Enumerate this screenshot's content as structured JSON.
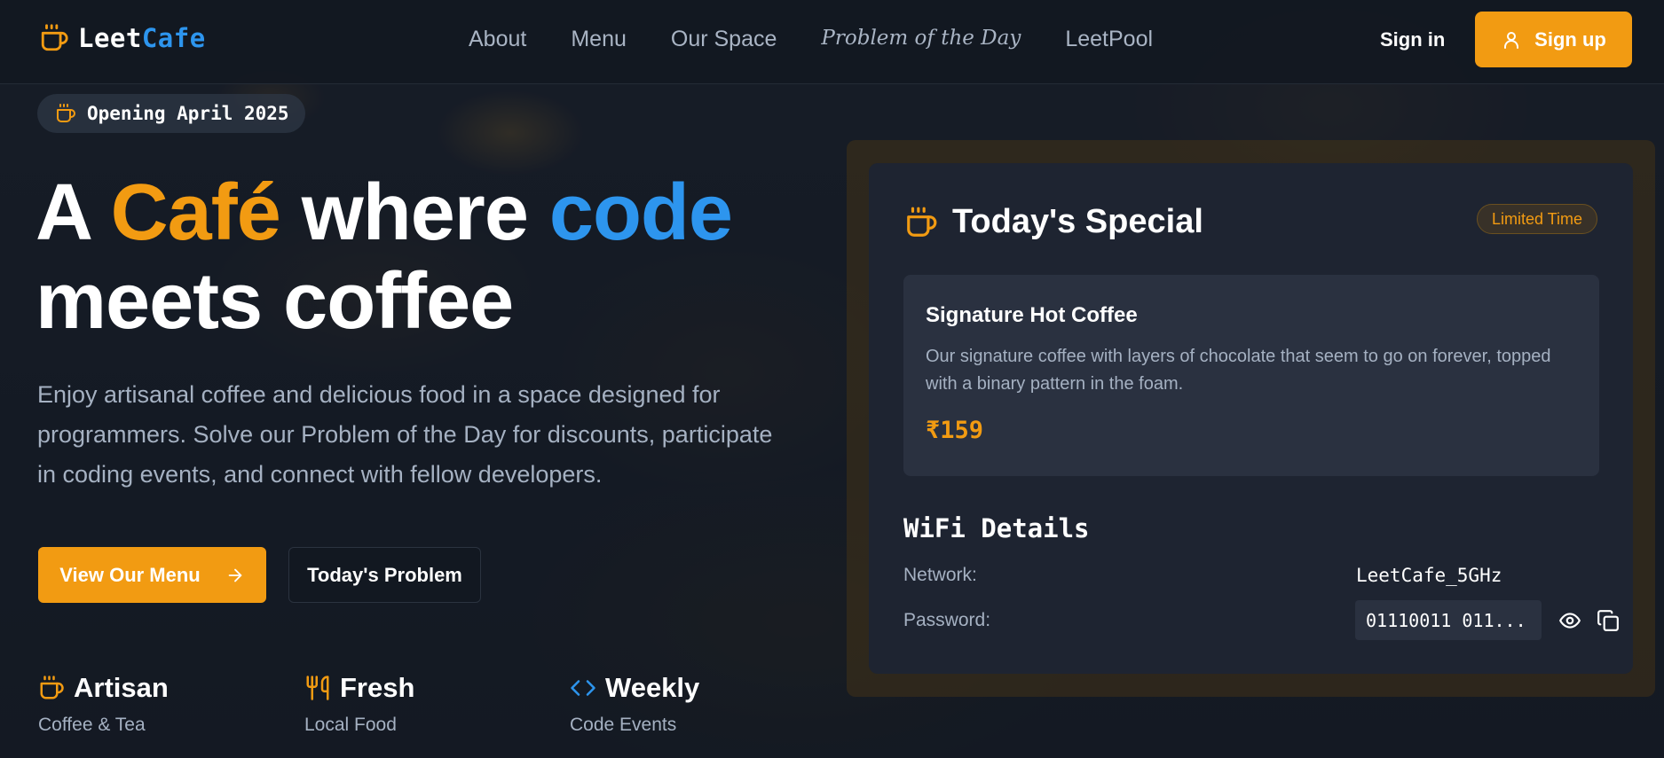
{
  "colors": {
    "accent": "#f29b12",
    "brand_blue": "#2d95ee",
    "muted": "#a5b1c2",
    "card": "#1e2431"
  },
  "header": {
    "logo_part1": "Leet",
    "logo_part2": "Cafe",
    "logo_icon": "coffee-cup-icon",
    "nav": [
      "About",
      "Menu",
      "Our Space",
      "Problem of the Day",
      "LeetPool"
    ],
    "signin": "Sign in",
    "signup": "Sign up",
    "signup_icon": "user-icon"
  },
  "hero": {
    "badge": "Opening April 2025",
    "title_a": "A",
    "title_cafe": "Café",
    "title_where": "where",
    "title_code": "code",
    "title_line2": "meets coffee",
    "description": "Enjoy artisanal coffee and delicious food in a space designed for programmers. Solve our Problem of the Day for discounts, participate in coding events, and connect with fellow developers.",
    "btn_menu": "View Our Menu",
    "btn_problem": "Today's Problem",
    "features": [
      {
        "title": "Artisan",
        "sub": "Coffee & Tea",
        "icon": "coffee-cup-icon"
      },
      {
        "title": "Fresh",
        "sub": "Local Food",
        "icon": "utensils-icon"
      },
      {
        "title": "Weekly",
        "sub": "Code Events",
        "icon": "code-icon"
      }
    ]
  },
  "special": {
    "title": "Today's Special",
    "tag": "Limited Time",
    "item_name": "Signature Hot Coffee",
    "item_desc": "Our signature coffee with layers of chocolate that seem to go on forever, topped with a binary pattern in the foam.",
    "price": "₹159"
  },
  "wifi": {
    "title": "WiFi Details",
    "network_label": "Network:",
    "network_value": "LeetCafe_5GHz",
    "password_label": "Password:",
    "password_value": "01110011 011..."
  }
}
